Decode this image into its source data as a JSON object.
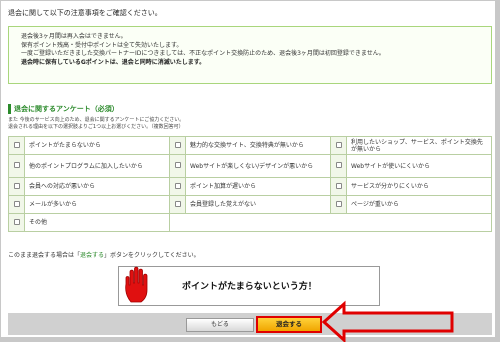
{
  "intro": {
    "title": "退会に関して以下の注意事項をご確認ください。"
  },
  "notices": [
    {
      "text": "退会後3ヶ月間は再入会はできません。",
      "bold": false
    },
    {
      "text": "保有ポイント残高・受付中ポイントは全て失効いたします。",
      "bold": false
    },
    {
      "text": "一度ご登録いただきました交換パートナーIDにつきましては、不正なポイント交換防止のため、退会後3ヶ月間は初回登録できません。",
      "bold": false
    },
    {
      "text": "退会時に保有しているGポイントは、退会と同時に消滅いたします。",
      "bold": true
    }
  ],
  "survey": {
    "title": "退会に関するアンケート（必須）",
    "desc_line1": "また 今後のサービス向上のため、退会に関するアンケートにご協力ください。",
    "desc_line2": "退会される理由を以下の選択肢よりご1つ以上お選びください。（複数回答可）",
    "rows": [
      [
        "ポイントがたまらないから",
        "魅力的な交換サイト、交換特典が無いから",
        "利用したいショップ、サービス、ポイント交換先が無いから"
      ],
      [
        "他のポイントプログラムに加入したいから",
        "Webサイトが楽しくない/デザインが悪いから",
        "Webサイトが使いにくいから"
      ],
      [
        "会員への対応が悪いから",
        "ポイント加算が遅いから",
        "サービスが分かりにくいから"
      ],
      [
        "メールが多いから",
        "会員登録した覚えがない",
        "ページが重いから"
      ]
    ],
    "last_option": "その他"
  },
  "instruction": {
    "prefix": "このまま退会する場合は「",
    "accent": "退会する",
    "suffix": "」ボタンをクリックしてください。"
  },
  "banner": {
    "text": "ポイントがたまらないという方！"
  },
  "buttons": {
    "back": "もどる",
    "withdraw": "退会する"
  },
  "colors": {
    "accent_green": "#2b8a2b",
    "highlight_red": "#e00000",
    "button_yellow": "#f5b400"
  },
  "icons": [
    "hand-icon",
    "arrow-left-icon",
    "checkbox-icon"
  ]
}
